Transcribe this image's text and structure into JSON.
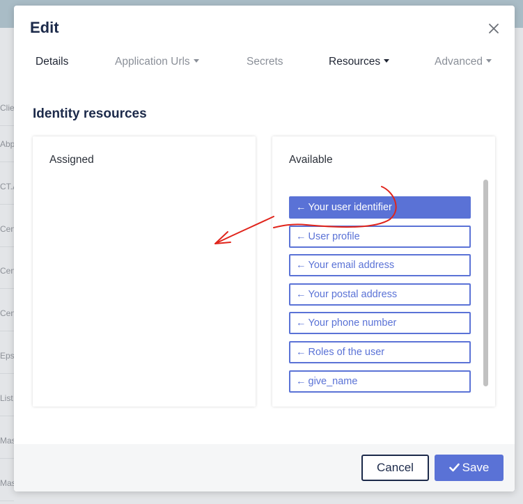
{
  "background": {
    "rows": [
      "Clie",
      "Abp",
      "CT.A",
      "Cen",
      "Cen",
      "Cen",
      "Eps",
      "List",
      "Mas",
      "Mas"
    ]
  },
  "modal": {
    "title": "Edit",
    "close_icon": "close-icon"
  },
  "tabs": [
    {
      "label": "Details",
      "dropdown": false,
      "active": true
    },
    {
      "label": "Application Urls",
      "dropdown": true,
      "active": false
    },
    {
      "label": "Secrets",
      "dropdown": false,
      "active": false
    },
    {
      "label": "Resources",
      "dropdown": true,
      "active": true
    },
    {
      "label": "Advanced",
      "dropdown": true,
      "active": false
    }
  ],
  "section": {
    "title": "Identity resources"
  },
  "assigned": {
    "label": "Assigned",
    "items": []
  },
  "available": {
    "label": "Available",
    "arrow": "←",
    "items": [
      {
        "label": "Your user identifier",
        "selected": true
      },
      {
        "label": "User profile",
        "selected": false
      },
      {
        "label": "Your email address",
        "selected": false
      },
      {
        "label": "Your postal address",
        "selected": false
      },
      {
        "label": "Your phone number",
        "selected": false
      },
      {
        "label": "Roles of the user",
        "selected": false
      },
      {
        "label": "give_name",
        "selected": false
      }
    ]
  },
  "footer": {
    "cancel_label": "Cancel",
    "save_label": "Save"
  },
  "colors": {
    "accent": "#5a72d6",
    "title": "#1c2a4a",
    "annotation": "#e0241b"
  }
}
